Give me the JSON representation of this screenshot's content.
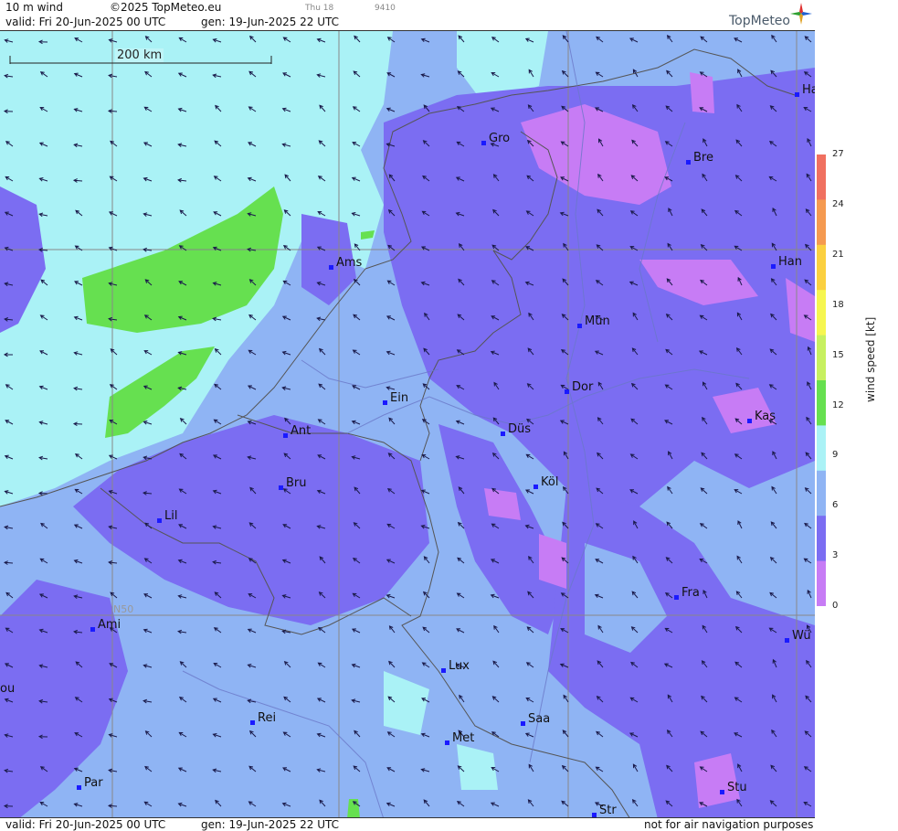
{
  "header": {
    "product": "10 m wind",
    "copyright": "©2025 TopMeteo.eu",
    "tab_small": "Thu 18",
    "tab_code": "9410",
    "valid": "valid:  Fri  20-Jun-2025  00 UTC",
    "gen": "gen: 19-Jun-2025 22 UTC"
  },
  "footer": {
    "valid": "valid:  Fri  20-Jun-2025  00 UTC",
    "gen": "gen: 19-Jun-2025 22 UTC",
    "disclaimer": "not for air navigation purposes"
  },
  "logo": {
    "text": "TopMeteo"
  },
  "scale": {
    "label": "200 km"
  },
  "grid": {
    "lat_label": "N50"
  },
  "legend": {
    "title": "wind  speed  [kt]",
    "ticks": [
      "27",
      "24",
      "21",
      "18",
      "15",
      "12",
      "9",
      "6",
      "3",
      "0"
    ],
    "colors": [
      "#f07060",
      "#f59a50",
      "#fbd040",
      "#f6f650",
      "#c7f060",
      "#66e050",
      "#aaf2f6",
      "#8fb4f4",
      "#7b6df2",
      "#c77cf5"
    ]
  },
  "cities": [
    {
      "name": "Gro"
    },
    {
      "name": "Bre"
    },
    {
      "name": "Ha"
    },
    {
      "name": "Ams"
    },
    {
      "name": "Han"
    },
    {
      "name": "Mün"
    },
    {
      "name": "Ein"
    },
    {
      "name": "Dor"
    },
    {
      "name": "Kas"
    },
    {
      "name": "Ant"
    },
    {
      "name": "Düs"
    },
    {
      "name": "Bru"
    },
    {
      "name": "Köl"
    },
    {
      "name": "Lil"
    },
    {
      "name": "Fra"
    },
    {
      "name": "Ami"
    },
    {
      "name": "Wü"
    },
    {
      "name": "Lux"
    },
    {
      "name": "ou"
    },
    {
      "name": "Rei"
    },
    {
      "name": "Saa"
    },
    {
      "name": "Met"
    },
    {
      "name": "Par"
    },
    {
      "name": "Stu"
    },
    {
      "name": "Str"
    }
  ]
}
